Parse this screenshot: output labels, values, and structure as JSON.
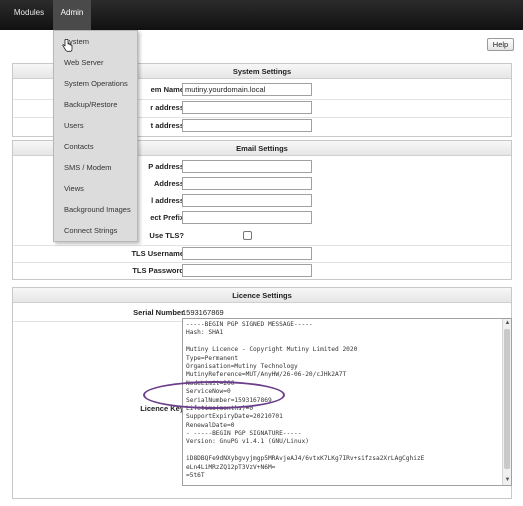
{
  "nav": {
    "items": [
      {
        "label": "Modules"
      },
      {
        "label": "Admin"
      }
    ]
  },
  "help_label": "Help",
  "admin_menu": {
    "items": [
      "System",
      "Web Server",
      "System Operations",
      "Backup/Restore",
      "Users",
      "Contacts",
      "SMS / Modem",
      "Views",
      "Background Images",
      "Connect Strings"
    ]
  },
  "system_settings": {
    "title": "System Settings",
    "rows": [
      {
        "label": "System Name",
        "visible_label": "em Name",
        "value": "mutiny.yourdomain.local"
      },
      {
        "label": "IP address",
        "visible_label": "r address",
        "value": ""
      },
      {
        "label": "Gateway address",
        "visible_label": "t address",
        "value": ""
      }
    ]
  },
  "email_settings": {
    "title": "Email Settings",
    "rows": [
      {
        "visible_label": "P address",
        "value": ""
      },
      {
        "visible_label": "Address",
        "value": ""
      },
      {
        "visible_label": "l address",
        "value": ""
      },
      {
        "visible_label": "ect Prefix",
        "value": ""
      },
      {
        "visible_label": "Use TLS?",
        "type": "checkbox",
        "checked": false
      },
      {
        "visible_label": "TLS Username",
        "value": ""
      },
      {
        "visible_label": "TLS Password",
        "value": ""
      }
    ]
  },
  "licence_settings": {
    "title": "Licence Settings",
    "serial_label": "Serial Number",
    "serial_value": "1593167869",
    "key_label": "Licence Key",
    "key_lines": [
      "-----BEGIN PGP SIGNED MESSAGE-----",
      "Hash: SHA1",
      "",
      "Mutiny Licence - Copyright Mutiny Limited 2020",
      "Type=Permanent",
      "Organisation=Mutiny Technology",
      "MutinyReference=MUT/AnyHW/26-06-20/cJHk2A7T",
      "NodeLimit=200",
      "ServiceNow=0",
      "SerialNumber=1593167869",
      "Lifetime(months)=0",
      "SupportExpiryDate=20210701",
      "RenewalDate=0",
      "- -----BEGIN PGP SIGNATURE-----",
      "Version: GnuPG v1.4.1 (GNU/Linux)",
      "",
      "iD8DBQFe9dNXybgvyjmgp5MRAvjeAJ4/6vtxK7LKg7IRv+sifzsa2XrLAgCghizE",
      "eLn4LiMRzZQ12pT3VzV+N6M=",
      "=5t6T"
    ]
  },
  "colors": {
    "topbar": "#1b1b1b",
    "dropdown": "#dcdcdc",
    "annotation": "#6b3e8c"
  }
}
